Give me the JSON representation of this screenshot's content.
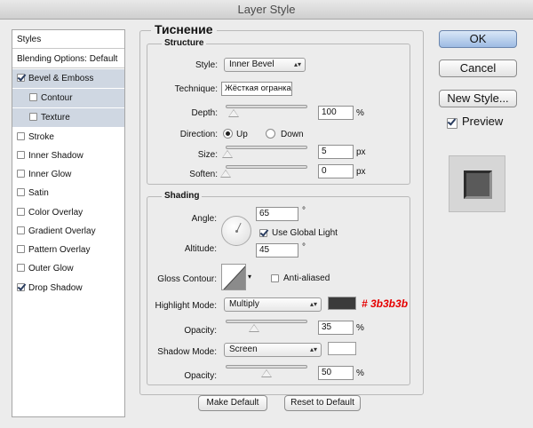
{
  "window": {
    "title": "Layer Style"
  },
  "styles_list": {
    "items": [
      {
        "label": "Styles",
        "checked": null
      },
      {
        "label": "Blending Options: Default",
        "checked": null
      },
      {
        "label": "Bevel & Emboss",
        "checked": true
      },
      {
        "label": "Contour",
        "checked": false
      },
      {
        "label": "Texture",
        "checked": false
      },
      {
        "label": "Stroke",
        "checked": false
      },
      {
        "label": "Inner Shadow",
        "checked": false
      },
      {
        "label": "Inner Glow",
        "checked": false
      },
      {
        "label": "Satin",
        "checked": false
      },
      {
        "label": "Color Overlay",
        "checked": false
      },
      {
        "label": "Gradient Overlay",
        "checked": false
      },
      {
        "label": "Pattern Overlay",
        "checked": false
      },
      {
        "label": "Outer Glow",
        "checked": false
      },
      {
        "label": "Drop Shadow",
        "checked": true
      }
    ]
  },
  "panel": {
    "title": "Тиснение"
  },
  "structure": {
    "title": "Structure",
    "style_label": "Style:",
    "style_value": "Inner Bevel",
    "technique_label": "Technique:",
    "technique_value": "Жёсткая огранка",
    "depth_label": "Depth:",
    "depth_value": "100",
    "depth_unit": "%",
    "depth_slider": 0.1,
    "direction_label": "Direction:",
    "direction_up": "Up",
    "direction_down": "Down",
    "direction_selected": "Up",
    "size_label": "Size:",
    "size_value": "5",
    "size_unit": "px",
    "size_slider": 0.02,
    "soften_label": "Soften:",
    "soften_value": "0",
    "soften_unit": "px",
    "soften_slider": 0.0
  },
  "shading": {
    "title": "Shading",
    "angle_label": "Angle:",
    "angle_value": "65",
    "angle_unit": "°",
    "use_global_light": "Use Global Light",
    "use_global_light_checked": true,
    "altitude_label": "Altitude:",
    "altitude_value": "45",
    "altitude_unit": "°",
    "gloss_contour_label": "Gloss Contour:",
    "anti_aliased": "Anti-aliased",
    "anti_aliased_checked": false,
    "highlight_mode_label": "Highlight Mode:",
    "highlight_mode_value": "Multiply",
    "highlight_color": "#3b3b3b",
    "highlight_opacity_label": "Opacity:",
    "highlight_opacity_value": "35",
    "highlight_opacity_unit": "%",
    "highlight_opacity_slider": 0.35,
    "shadow_mode_label": "Shadow Mode:",
    "shadow_mode_value": "Screen",
    "shadow_color": "#ffffff",
    "shadow_opacity_label": "Opacity:",
    "shadow_opacity_value": "50",
    "shadow_opacity_unit": "%",
    "shadow_opacity_slider": 0.5
  },
  "annotation": "# 3b3b3b",
  "buttons": {
    "make_default": "Make Default",
    "reset_default": "Reset to Default",
    "ok": "OK",
    "cancel": "Cancel",
    "new_style": "New Style...",
    "preview": "Preview",
    "preview_checked": true
  }
}
